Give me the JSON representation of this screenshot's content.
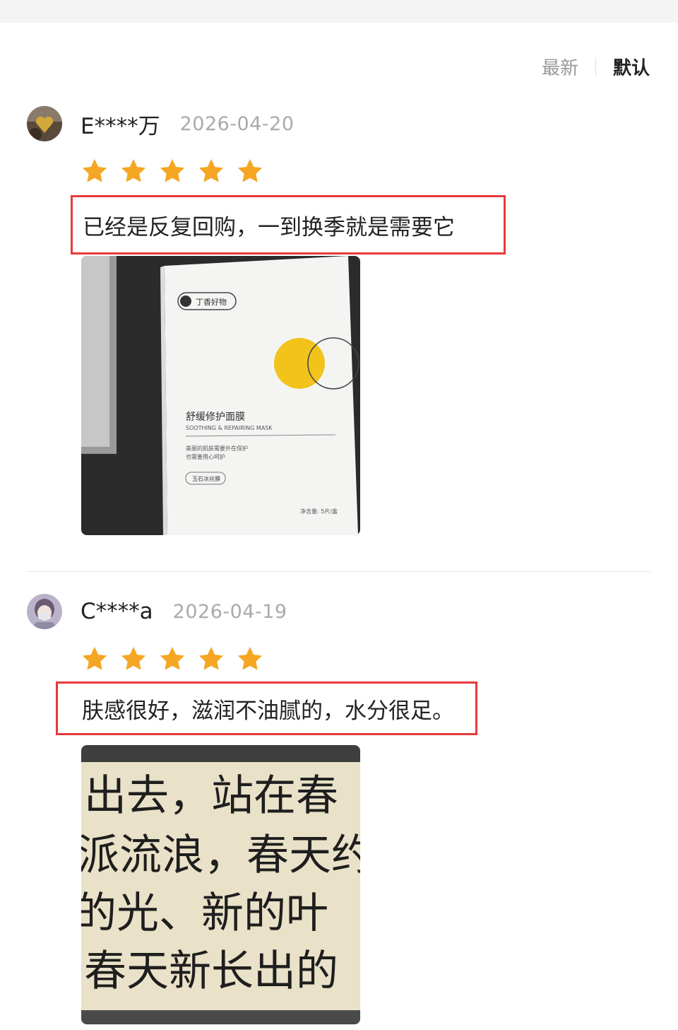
{
  "sort": {
    "latest": "最新",
    "default": "默认",
    "selected": "默认"
  },
  "reviews": [
    {
      "user": "E****万",
      "date": "2026-04-20",
      "rating": 5,
      "comment": "已经是反复回购，一到换季就是需要它",
      "photo": {
        "brand": "丁香好物",
        "product_cn": "舒缓修护面膜",
        "product_en": "SOOTHING & REPAIRING MASK",
        "slogan_1": "美丽的肌肤需要外在保护",
        "slogan_2": "也需要用心呵护",
        "tag": "玉石冰丝膜",
        "net": "净含量: 5片/盒"
      }
    },
    {
      "user": "C****a",
      "date": "2026-04-19",
      "rating": 5,
      "comment": "肤感很好，滋润不油腻的，水分很足。",
      "photo": {
        "lines": [
          "出去，站在春",
          "派流浪，春天约",
          "的光、新的叶",
          "春天新长出的"
        ]
      }
    }
  ],
  "colors": {
    "star": "#f5a623",
    "highlight": "#e8393a",
    "mask_dot": "#f2c31b"
  }
}
